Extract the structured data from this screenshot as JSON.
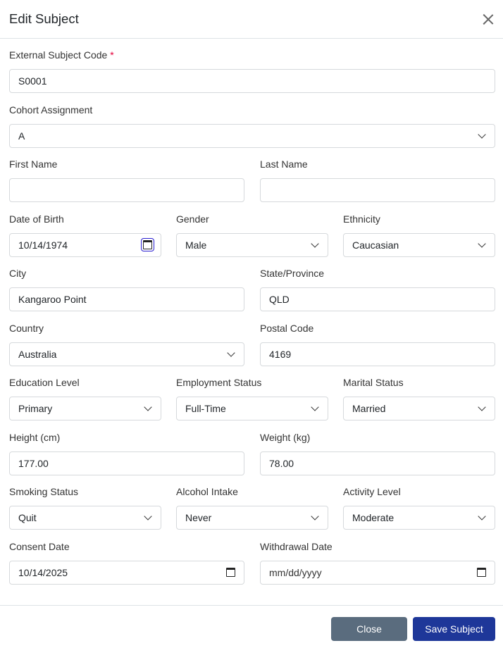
{
  "dialog": {
    "title": "Edit Subject"
  },
  "fields": {
    "external_code": {
      "label": "External Subject Code",
      "required_mark": "*",
      "value": "S0001"
    },
    "cohort": {
      "label": "Cohort Assignment",
      "value": "A"
    },
    "first_name": {
      "label": "First Name",
      "value": ""
    },
    "last_name": {
      "label": "Last Name",
      "value": ""
    },
    "dob": {
      "label": "Date of Birth",
      "value": "10/14/1974"
    },
    "gender": {
      "label": "Gender",
      "value": "Male"
    },
    "ethnicity": {
      "label": "Ethnicity",
      "value": "Caucasian"
    },
    "city": {
      "label": "City",
      "value": "Kangaroo Point"
    },
    "state": {
      "label": "State/Province",
      "value": "QLD"
    },
    "country": {
      "label": "Country",
      "value": "Australia"
    },
    "postal": {
      "label": "Postal Code",
      "value": "4169"
    },
    "education": {
      "label": "Education Level",
      "value": "Primary"
    },
    "employment": {
      "label": "Employment Status",
      "value": "Full-Time"
    },
    "marital": {
      "label": "Marital Status",
      "value": "Married"
    },
    "height": {
      "label": "Height (cm)",
      "value": "177.00"
    },
    "weight": {
      "label": "Weight (kg)",
      "value": "78.00"
    },
    "smoking": {
      "label": "Smoking Status",
      "value": "Quit"
    },
    "alcohol": {
      "label": "Alcohol Intake",
      "value": "Never"
    },
    "activity": {
      "label": "Activity Level",
      "value": "Moderate"
    },
    "consent": {
      "label": "Consent Date",
      "value": "10/14/2025"
    },
    "withdrawal": {
      "label": "Withdrawal Date",
      "value": "mm/dd/yyyy"
    }
  },
  "footer": {
    "close_label": "Close",
    "save_label": "Save Subject"
  }
}
